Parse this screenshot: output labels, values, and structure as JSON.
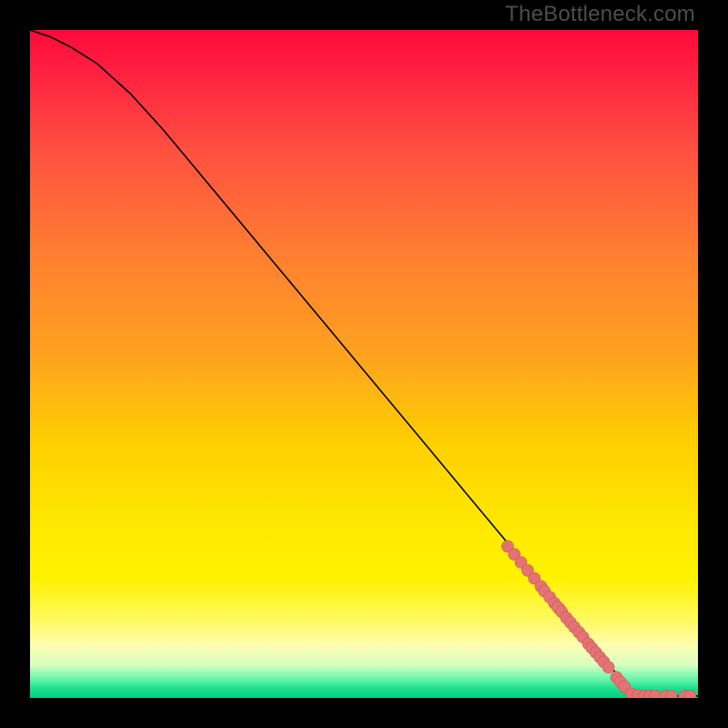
{
  "watermark": "TheBottleneck.com",
  "colors": {
    "background": "#000000",
    "curve_stroke": "#000000",
    "point_fill": "#e57373",
    "point_stroke": "#c85a5a"
  },
  "chart_data": {
    "type": "line",
    "title": "",
    "xlabel": "",
    "ylabel": "",
    "xlim": [
      0,
      100
    ],
    "ylim": [
      0,
      100
    ],
    "curve": {
      "x": [
        0,
        3,
        6,
        10,
        15,
        20,
        25,
        30,
        35,
        40,
        45,
        50,
        55,
        60,
        65,
        70,
        75,
        80,
        82,
        84,
        86,
        88,
        90,
        92,
        94,
        96,
        98,
        100
      ],
      "y": [
        100,
        99,
        97.5,
        95,
        90.5,
        85,
        79,
        73,
        67,
        61,
        55,
        49,
        43,
        37,
        31,
        25,
        19,
        13,
        10.6,
        8.2,
        5.8,
        3.4,
        1.2,
        0.4,
        0.3,
        0.3,
        0.3,
        0.3
      ]
    },
    "points": {
      "x": [
        71.5,
        72.5,
        73.5,
        74.5,
        75.5,
        76.5,
        77.0,
        77.8,
        78.5,
        79.2,
        79.0,
        79.6,
        80.3,
        80.9,
        81.5,
        82.2,
        82.8,
        83.6,
        84.1,
        84.7,
        85.3,
        85.9,
        86.6,
        87.8,
        88.4,
        89.0,
        90.0,
        91.0,
        92.0,
        92.8,
        93.6,
        95.2,
        96.0,
        98.0,
        98.8
      ],
      "y": [
        22.7,
        21.5,
        20.3,
        19.1,
        17.9,
        16.7,
        16.0,
        15.1,
        14.2,
        13.4,
        13.6,
        12.9,
        12.0,
        11.3,
        10.6,
        9.8,
        9.1,
        8.1,
        7.5,
        6.8,
        6.1,
        5.4,
        4.6,
        3.1,
        2.4,
        1.7,
        0.6,
        0.4,
        0.3,
        0.3,
        0.3,
        0.3,
        0.3,
        0.3,
        0.3
      ]
    }
  }
}
